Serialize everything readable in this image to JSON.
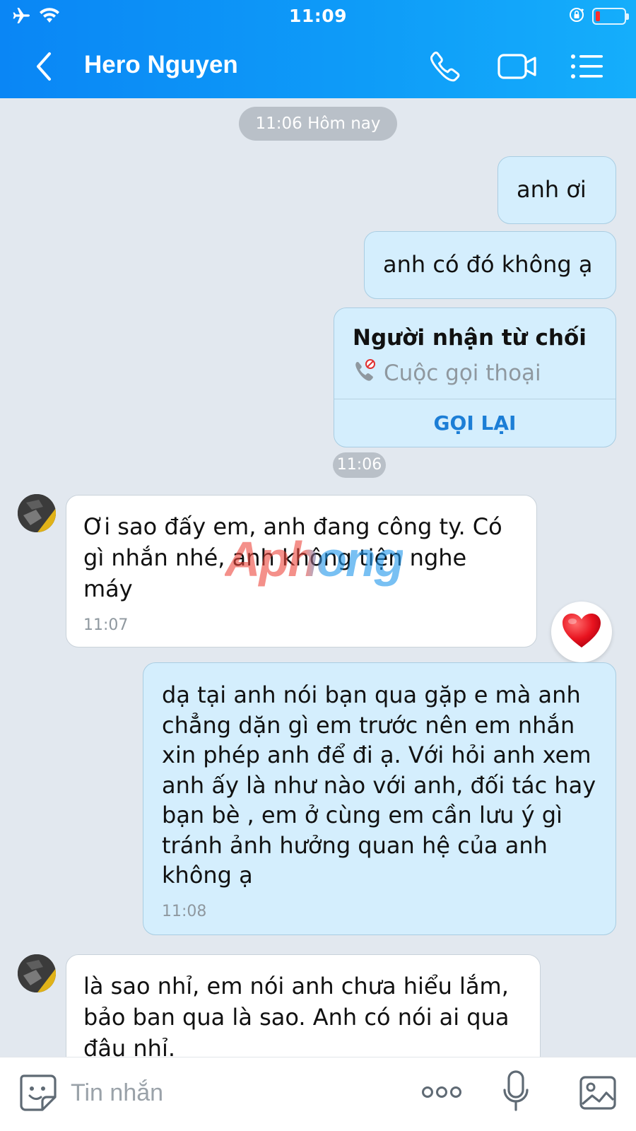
{
  "status_bar": {
    "time": "11:09"
  },
  "header": {
    "contact_name": "Hero Nguyen"
  },
  "chat": {
    "date_separator": "11:06 Hôm nay",
    "messages": [
      {
        "direction": "outgoing",
        "text": "anh ơi"
      },
      {
        "direction": "outgoing",
        "text": "anh có đó không ạ"
      },
      {
        "direction": "outgoing",
        "type": "call",
        "title": "Người nhận từ chối",
        "subtitle": "Cuộc gọi thoại",
        "action_label": "GỌI LẠI"
      },
      {
        "type": "time",
        "text": "11:06"
      },
      {
        "direction": "incoming",
        "text": "Ơi sao đấy em, anh đang công ty. Có gì nhắn nhé, anh không tiện nghe máy",
        "time": "11:07",
        "reaction": "heart"
      },
      {
        "direction": "outgoing",
        "text": "dạ tại anh nói bạn qua gặp e mà anh chẳng dặn gì em trước nên em nhắn xin phép anh để đi ạ. Với hỏi anh xem anh ấy là như nào với anh, đối tác hay bạn bè , em ở cùng em cần lưu ý gì tránh ảnh hưởng quan hệ của anh không ạ",
        "time": "11:08"
      },
      {
        "direction": "incoming",
        "text": "là sao nhỉ, em nói anh chưa hiểu lắm, bảo ban qua là sao. Anh có nói ai qua đâu nhỉ."
      }
    ]
  },
  "watermark": "Aphong",
  "input_bar": {
    "placeholder": "Tin nhắn"
  },
  "icons": {
    "back": "chevron-left-icon",
    "call": "phone-icon",
    "video": "video-camera-icon",
    "menu": "list-menu-icon",
    "emoji": "sticker-face-icon",
    "more": "ellipsis-icon",
    "mic": "microphone-icon",
    "image": "image-icon"
  },
  "colors": {
    "header": "#0e9bf8",
    "outgoing_bubble": "#d4eefd",
    "incoming_bubble": "#ffffff",
    "chat_background": "#e2e8ef",
    "recall_action": "#1c7ed6"
  }
}
